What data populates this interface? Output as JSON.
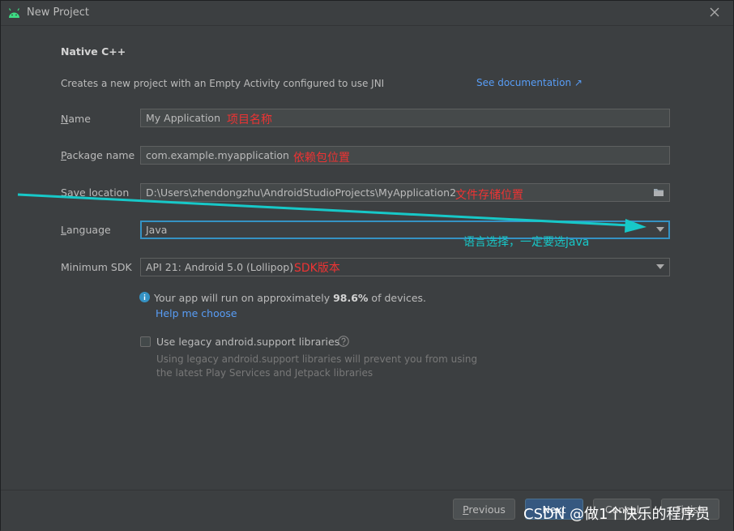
{
  "window": {
    "title": "New Project"
  },
  "template_name": "Native C++",
  "description": "Creates a new project with an Empty Activity configured to use JNI",
  "see_documentation": "See documentation ↗",
  "fields": {
    "name": {
      "label_first": "N",
      "label_rest": "ame",
      "value": "My Application"
    },
    "package": {
      "label_first": "P",
      "label_rest": "ackage name",
      "value": "com.example.myapplication"
    },
    "save_location": {
      "label_first": "S",
      "label_rest": "ave location",
      "value": "D:\\Users\\zhendongzhu\\AndroidStudioProjects\\MyApplication2"
    },
    "language": {
      "label_first": "L",
      "label_rest": "anguage",
      "value": "Java"
    },
    "min_sdk": {
      "label": "Minimum SDK",
      "value": "API 21: Android 5.0 (Lollipop)"
    }
  },
  "info": {
    "prefix": "Your app will run on approximately ",
    "percent": "98.6%",
    "suffix": " of devices.",
    "help_link": "Help me choose"
  },
  "legacy": {
    "label": "Use legacy android.support libraries",
    "note_line1": "Using legacy android.support libraries will prevent you from using",
    "note_line2": "the latest Play Services and Jetpack libraries",
    "checked": false
  },
  "annotations": {
    "name": "项目名称",
    "package": "依赖包位置",
    "save_location": "文件存储位置",
    "language": "语言选择，一定要选java",
    "min_sdk": "SDK版本"
  },
  "buttons": {
    "previous_first": "P",
    "previous_rest": "revious",
    "next": "Next",
    "cancel": "Cancel",
    "finish": "Finish"
  },
  "watermark": "CSDN @做1个快乐的程序员",
  "colors": {
    "accent": "#589df6",
    "annotation_red": "#ee3333",
    "annotation_cyan": "#17c8c8",
    "focus_border": "#3592c4"
  }
}
